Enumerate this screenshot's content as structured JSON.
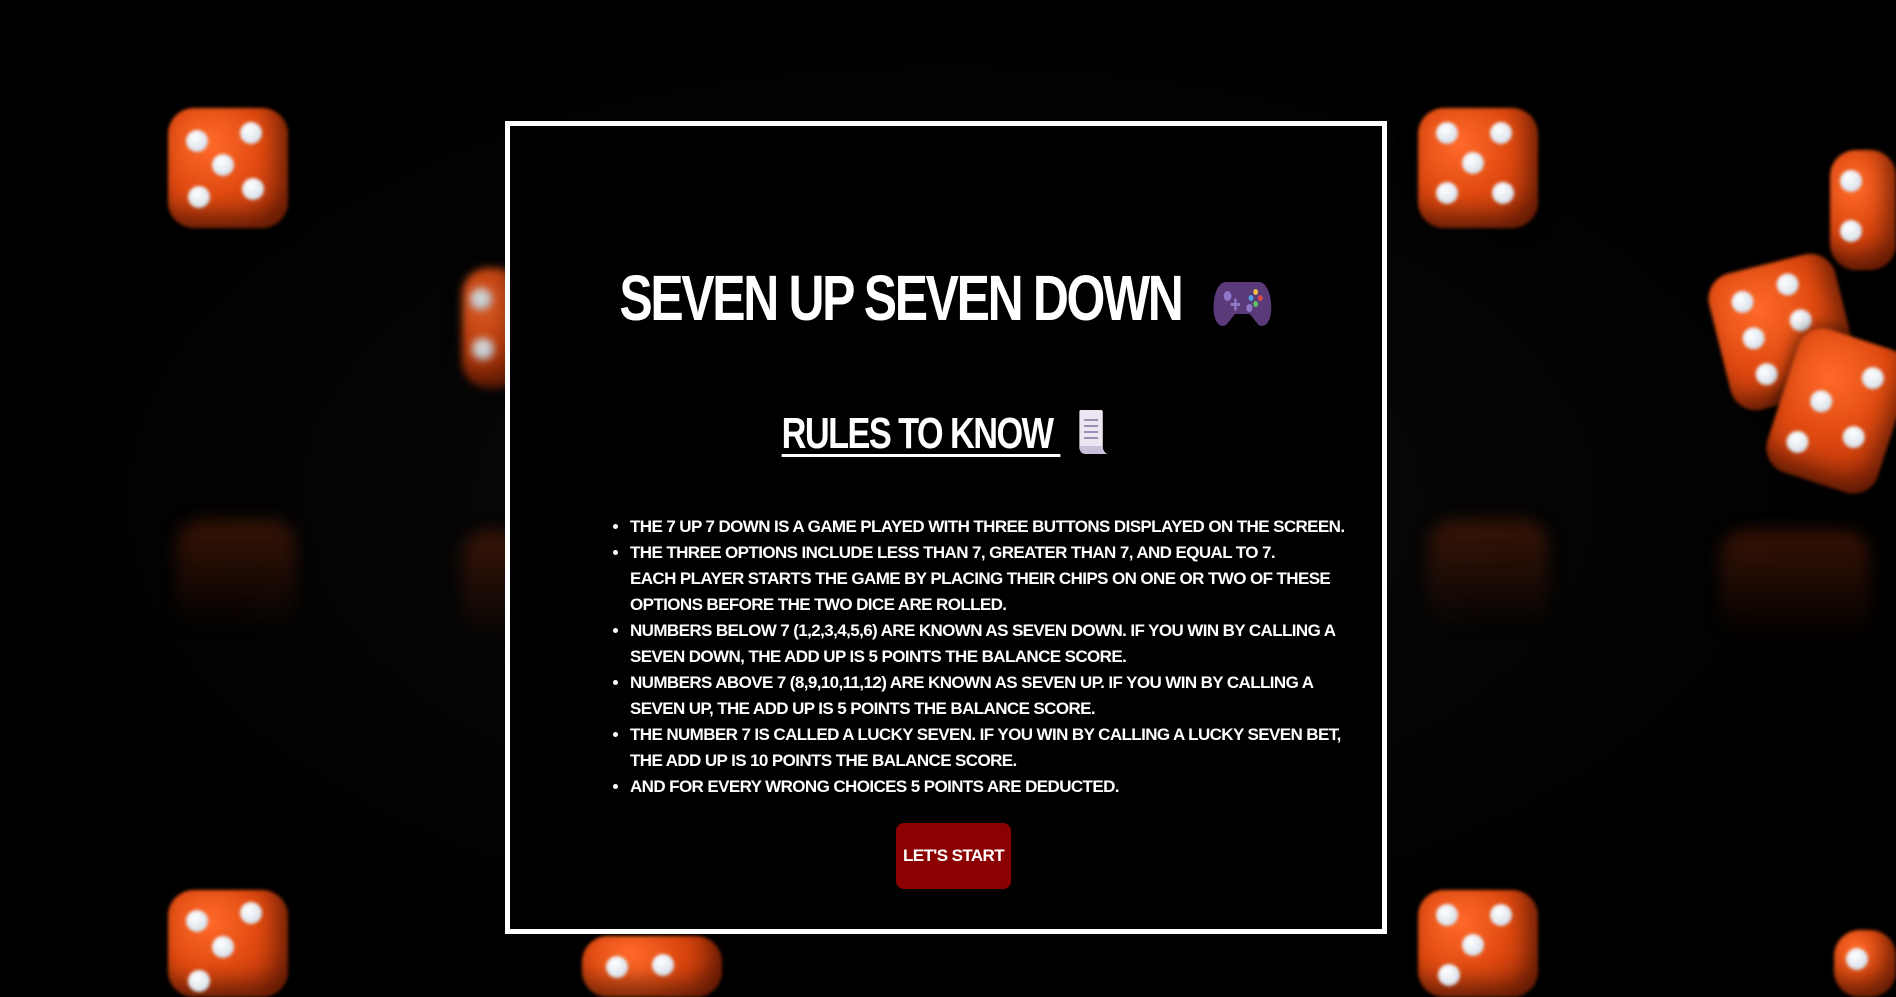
{
  "page": {
    "title": "SEVEN UP SEVEN DOWN",
    "title_icon": "game-controller-icon",
    "rules_heading": "RULES TO KNOW",
    "rules_heading_icon": "scroll-icon"
  },
  "rules": [
    {
      "line1": "The 7 up 7 down is a game played with three buttons displayed on the screen.",
      "line2": ""
    },
    {
      "line1": "The three options include less than 7, greater than 7, and equal to 7.",
      "line2": "Each player starts the game by placing their chips on one or two of these options before the two dice are rolled."
    },
    {
      "line1": "Numbers below 7 (1,2,3,4,5,6) are known as Seven down. If you win by calling a seven down, the add up is 5 points the balance score.",
      "line2": ""
    },
    {
      "line1": "Numbers above 7 (8,9,10,11,12) are known as Seven up. If you win by calling a seven up, the add up is 5 points the balance score.",
      "line2": ""
    },
    {
      "line1": "The number 7 is called a Lucky Seven. If you win by calling a Lucky seven bet, the add up is 10 points the balance score.",
      "line2": ""
    },
    {
      "line1": "And for every wrong choices 5 points are deducted.",
      "line2": ""
    }
  ],
  "start_button": {
    "label": "LET'S START"
  },
  "colors": {
    "background": "#000000",
    "panel_border": "#ffffff",
    "button_bg": "#8b0000",
    "dice": "#e04a10"
  }
}
